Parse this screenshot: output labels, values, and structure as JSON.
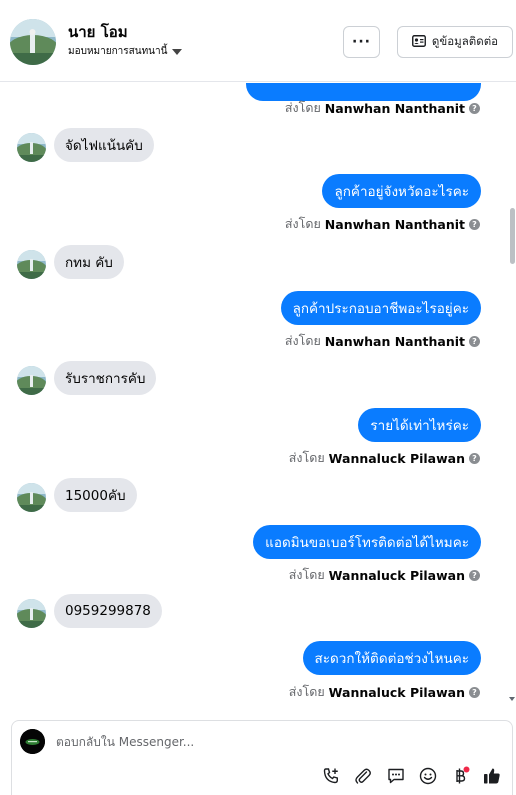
{
  "header": {
    "name": "นาย โอม",
    "assign_label": "มอบหมายการสนทนานี้",
    "more_label": "···",
    "contact_label": "ดูข้อมูลติดต่อ"
  },
  "messages": [
    {
      "type": "sent_by",
      "prefix": "ส่งโดย",
      "sender": "Nanwhan Nanthanit"
    },
    {
      "type": "in",
      "text": "จัดไฟแน้นคับ"
    },
    {
      "type": "out",
      "text": "ลูกค้าอยู่จังหวัดอะไรคะ"
    },
    {
      "type": "sent_by",
      "prefix": "ส่งโดย",
      "sender": "Nanwhan Nanthanit"
    },
    {
      "type": "in",
      "text": "กทม คับ"
    },
    {
      "type": "out",
      "text": "ลูกค้าประกอบอาชีพอะไรอยู่คะ"
    },
    {
      "type": "sent_by",
      "prefix": "ส่งโดย",
      "sender": "Nanwhan Nanthanit"
    },
    {
      "type": "in",
      "text": "รับราชการคับ"
    },
    {
      "type": "out",
      "text": "รายได้เท่าไหร่คะ"
    },
    {
      "type": "sent_by",
      "prefix": "ส่งโดย",
      "sender": "Wannaluck Pilawan"
    },
    {
      "type": "in",
      "text": "15000คับ"
    },
    {
      "type": "out",
      "text": "แอดมินขอเบอร์โทรติดต่อได้ไหมคะ"
    },
    {
      "type": "sent_by",
      "prefix": "ส่งโดย",
      "sender": "Wannaluck Pilawan"
    },
    {
      "type": "in",
      "text": "0959299878"
    },
    {
      "type": "out",
      "text": "สะดวกให้ติดต่อช่วงไหนคะ"
    },
    {
      "type": "sent_by",
      "prefix": "ส่งโดย",
      "sender": "Wannaluck Pilawan"
    }
  ],
  "composer": {
    "placeholder": "ตอบกลับใน Messenger..."
  },
  "icons": {
    "more": "more-icon",
    "contact": "contact-card-icon",
    "call": "call-add-icon",
    "attach": "paperclip-icon",
    "saved_reply": "saved-reply-icon",
    "emoji": "emoji-icon",
    "payment": "baht-icon",
    "like": "thumbs-up-icon"
  },
  "colors": {
    "bubble_out": "#0a7cff",
    "bubble_in": "#e4e6eb",
    "notification_dot": "#f02849"
  }
}
